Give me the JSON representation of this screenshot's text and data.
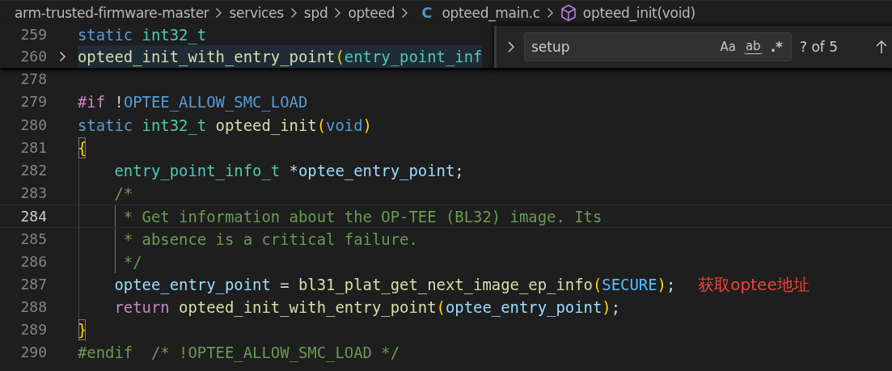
{
  "breadcrumb": [
    {
      "label": "arm-trusted-firmware-master",
      "kind": "folder"
    },
    {
      "label": "services",
      "kind": "folder"
    },
    {
      "label": "spd",
      "kind": "folder"
    },
    {
      "label": "opteed",
      "kind": "folder"
    },
    {
      "label": "opteed_main.c",
      "kind": "file",
      "icon_text": "C"
    },
    {
      "label": "opteed_init(void)",
      "kind": "symbol"
    }
  ],
  "find_widget": {
    "value": "setup",
    "expanded": false,
    "options": [
      {
        "label": "Aa",
        "kind": "case",
        "selected": false
      },
      {
        "label": "ab",
        "kind": "word",
        "selected": false
      },
      {
        "label": ".*",
        "kind": "regex",
        "selected": false
      }
    ],
    "result": "? of 5"
  },
  "sticky_lines": [
    {
      "number": "259",
      "tokens": [
        {
          "text": "static",
          "kind": "keyword"
        },
        {
          "text": " int32_t",
          "kind": "type"
        }
      ]
    },
    {
      "number": "260",
      "folded": true,
      "highlighted": true,
      "tokens": [
        {
          "text": "opteed_init_with_entry_point",
          "kind": "function"
        },
        {
          "text": "(",
          "kind": "bracket"
        },
        {
          "text": "entry_point_inf",
          "kind": "type"
        }
      ]
    }
  ],
  "lines": [
    {
      "number": "278"
    },
    {
      "number": "279",
      "tokens": [
        {
          "text": "#if",
          "kind": "preproc"
        },
        {
          "text": " !",
          "kind": "plain"
        },
        {
          "text": "OPTEE_ALLOW_SMC_LOAD",
          "kind": "keyword"
        }
      ]
    },
    {
      "number": "280",
      "tokens": [
        {
          "text": "static",
          "kind": "keyword"
        },
        {
          "text": " int32_t",
          "kind": "type"
        },
        {
          "text": " opteed_init",
          "kind": "function"
        },
        {
          "text": "(",
          "kind": "bracket"
        },
        {
          "text": "void",
          "kind": "keyword"
        },
        {
          "text": ")",
          "kind": "bracket"
        }
      ]
    },
    {
      "number": "281",
      "tokens": [
        {
          "text": "{",
          "kind": "bracket-match"
        }
      ]
    },
    {
      "number": "282",
      "tokens": [
        {
          "text": "    entry_point_info_t",
          "kind": "type"
        },
        {
          "text": " *",
          "kind": "plain"
        },
        {
          "text": "optee_entry_point",
          "kind": "variable"
        },
        {
          "text": ";",
          "kind": "plain"
        }
      ]
    },
    {
      "number": "283",
      "tokens": [
        {
          "text": "    /*",
          "kind": "comment"
        }
      ]
    },
    {
      "number": "284",
      "current": true,
      "tokens": [
        {
          "text": "     * Get information about the OP-TEE (BL32) image. Its",
          "kind": "guided-comment"
        }
      ]
    },
    {
      "number": "285",
      "tokens": [
        {
          "text": "     * absence is a critical failure.",
          "kind": "guided-comment"
        }
      ]
    },
    {
      "number": "286",
      "tokens": [
        {
          "text": "     */",
          "kind": "guided-comment"
        }
      ]
    },
    {
      "number": "287",
      "annotation": "获取optee地址",
      "tokens": [
        {
          "text": "    optee_entry_point",
          "kind": "variable"
        },
        {
          "text": " = ",
          "kind": "plain"
        },
        {
          "text": "bl31_plat_get_next_image_ep_info",
          "kind": "function"
        },
        {
          "text": "(",
          "kind": "bracket"
        },
        {
          "text": "SECURE",
          "kind": "constant"
        },
        {
          "text": ")",
          "kind": "bracket"
        },
        {
          "text": ";",
          "kind": "plain"
        }
      ]
    },
    {
      "number": "288",
      "tokens": [
        {
          "text": "    return",
          "kind": "preproc"
        },
        {
          "text": " opteed_init_with_entry_point",
          "kind": "function"
        },
        {
          "text": "(",
          "kind": "bracket"
        },
        {
          "text": "optee_entry_point",
          "kind": "variable"
        },
        {
          "text": ")",
          "kind": "bracket"
        },
        {
          "text": ";",
          "kind": "plain"
        }
      ]
    },
    {
      "number": "289",
      "tokens": [
        {
          "text": "}",
          "kind": "bracket-match"
        }
      ]
    },
    {
      "number": "290",
      "tokens": [
        {
          "text": "#endif  /* !OPTEE_ALLOW_SMC_LOAD */",
          "kind": "comment"
        }
      ]
    }
  ]
}
